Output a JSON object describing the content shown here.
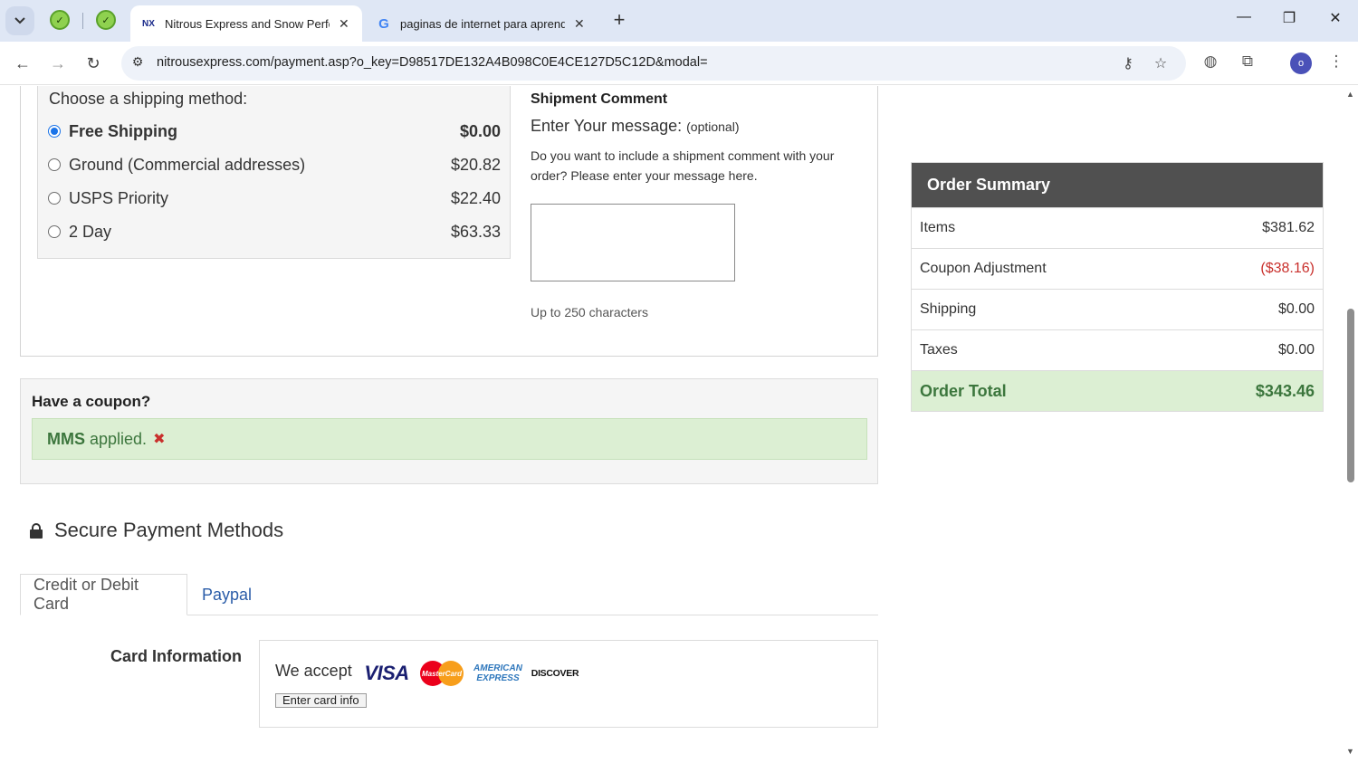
{
  "browser": {
    "tabs": [
      {
        "title": "Nitrous Express and Snow Perfo",
        "active": true
      },
      {
        "title": "paginas de internet para aprend",
        "active": false
      }
    ],
    "url": "nitrousexpress.com/payment.asp?o_key=D98517DE132A4B098C0E4CE127D5C12D&modal=",
    "profile_initial": "o"
  },
  "shipping": {
    "heading": "Choose a shipping method:",
    "options": [
      {
        "label": "Free Shipping",
        "price": "$0.00",
        "selected": true
      },
      {
        "label": "Ground (Commercial addresses)",
        "price": "$20.82",
        "selected": false
      },
      {
        "label": "USPS Priority",
        "price": "$22.40",
        "selected": false
      },
      {
        "label": "2 Day",
        "price": "$63.33",
        "selected": false
      }
    ]
  },
  "comment": {
    "title": "Shipment Comment",
    "label": "Enter Your message:",
    "optional": "(optional)",
    "help": "Do you want to include a shipment comment with your order? Please enter your message here.",
    "value": "",
    "limit": "Up to 250 characters"
  },
  "coupon": {
    "title": "Have a coupon?",
    "code": "MMS",
    "status": "applied."
  },
  "payment": {
    "title": "Secure Payment Methods",
    "tabs": [
      "Credit or Debit Card",
      "Paypal"
    ],
    "card_label": "Card Information",
    "accept_label": "We accept",
    "brands": {
      "visa": "VISA",
      "mastercard": "MasterCard",
      "amex_1": "AMERICAN",
      "amex_2": "EXPRESS",
      "discover": "DISCOVER"
    },
    "enter_button": "Enter card info"
  },
  "summary": {
    "title": "Order Summary",
    "rows": [
      {
        "label": "Items",
        "value": "$381.62"
      },
      {
        "label": "Coupon Adjustment",
        "value": "($38.16)"
      },
      {
        "label": "Shipping",
        "value": "$0.00"
      },
      {
        "label": "Taxes",
        "value": "$0.00"
      }
    ],
    "total_label": "Order Total",
    "total_value": "$343.46"
  },
  "colors": {
    "success_green": "#3c763d",
    "success_bg": "#dcefd3",
    "negative_red": "#c9302c",
    "link_blue": "#2a5ca8",
    "summary_head": "#505050"
  }
}
